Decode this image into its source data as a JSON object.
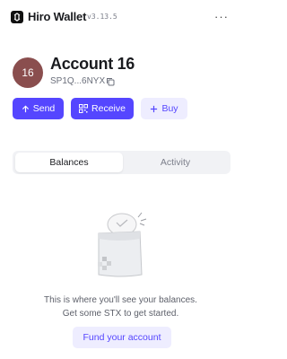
{
  "header": {
    "brand": "Hiro Wallet",
    "version": "v3.13.5",
    "logo_icon": "hiro-logo-icon",
    "menu_label": "···"
  },
  "account": {
    "avatar_text": "16",
    "avatar_color": "#8a4e4e",
    "name": "Account 16",
    "address": "SP1Q...6NYX",
    "copy_icon": "copy-icon"
  },
  "actions": {
    "send": {
      "icon": "arrow-up-icon",
      "label": "Send"
    },
    "receive": {
      "icon": "qr-code-icon",
      "label": "Receive"
    },
    "buy": {
      "icon": "plus-icon",
      "label": "Buy"
    }
  },
  "tabs": [
    {
      "label": "Balances",
      "active": true
    },
    {
      "label": "Activity",
      "active": false
    }
  ],
  "empty_state": {
    "illustration": "empty-wallet-illustration",
    "line1": "This is where you'll see your balances.",
    "line2": "Get some STX to get started.",
    "cta_label": "Fund your account"
  },
  "colors": {
    "accent": "#5546ff",
    "accent_light": "#eeedff",
    "text": "#1a1b1f",
    "muted": "#7b7e8a"
  }
}
